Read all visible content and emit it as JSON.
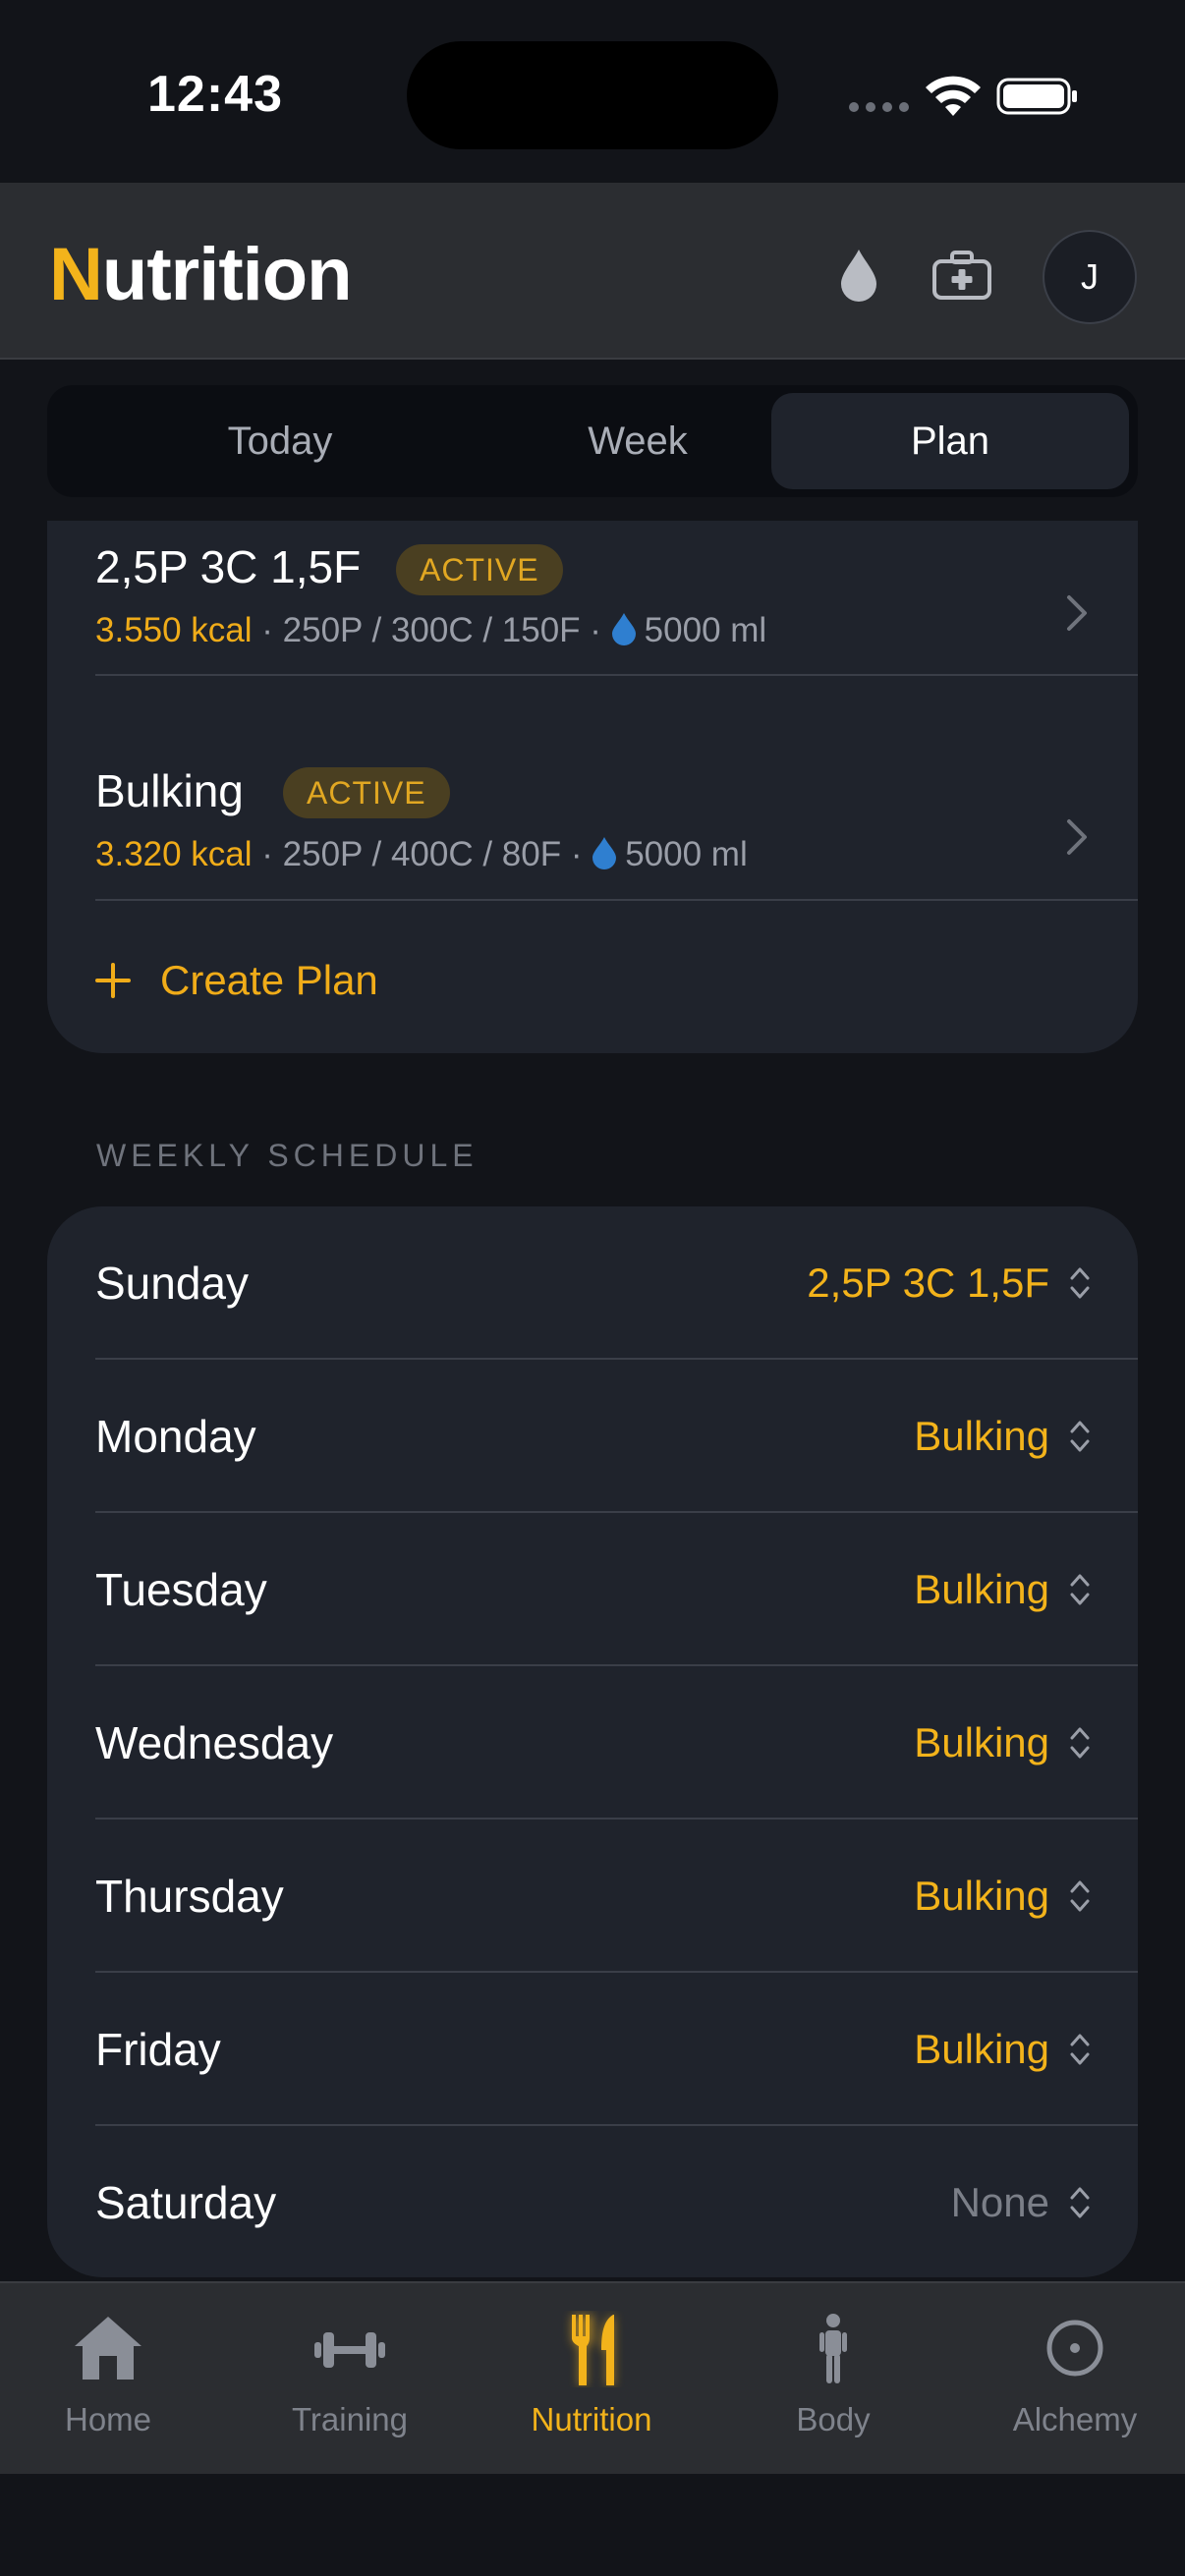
{
  "status_bar": {
    "time": "12:43"
  },
  "header": {
    "title_first": "N",
    "title_rest": "utrition",
    "icons": [
      "water-drop-icon",
      "first-aid-kit-icon"
    ],
    "avatar_initial": "J"
  },
  "segments": {
    "today": "Today",
    "week": "Week",
    "plan": "Plan",
    "selected": "Plan"
  },
  "plans": [
    {
      "name": "2,5P 3C 1,5F",
      "badge": "ACTIVE",
      "kcal": "3.550 kcal",
      "macros": " · 250P / 300C / 150F · ",
      "water": "5000 ml"
    },
    {
      "name": "Bulking",
      "badge": "ACTIVE",
      "kcal": "3.320 kcal",
      "macros": " · 250P / 400C / 80F · ",
      "water": "5000 ml"
    }
  ],
  "create_plan_label": "Create Plan",
  "schedule": {
    "label": "WEEKLY SCHEDULE",
    "days": [
      {
        "day": "Sunday",
        "plan": "2,5P 3C 1,5F"
      },
      {
        "day": "Monday",
        "plan": "Bulking"
      },
      {
        "day": "Tuesday",
        "plan": "Bulking"
      },
      {
        "day": "Wednesday",
        "plan": "Bulking"
      },
      {
        "day": "Thursday",
        "plan": "Bulking"
      },
      {
        "day": "Friday",
        "plan": "Bulking"
      },
      {
        "day": "Saturday",
        "plan": "None"
      }
    ]
  },
  "tabs": {
    "home": "Home",
    "training": "Training",
    "nutrition": "Nutrition",
    "body": "Body",
    "alchemy": "Alchemy",
    "selected": "Nutrition"
  },
  "colors": {
    "accent": "#f3b31b",
    "background": "#121419",
    "card": "#1f232c",
    "water": "#2f7fd0"
  }
}
